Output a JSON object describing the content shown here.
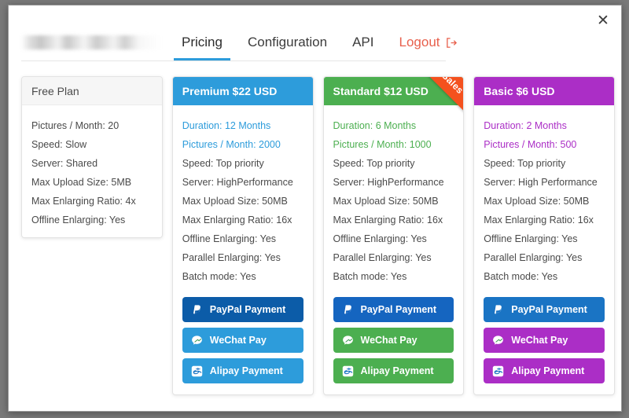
{
  "window": {
    "close_label": "✕"
  },
  "header": {
    "account_masked": "",
    "nav": [
      {
        "label": "Pricing",
        "active": true
      },
      {
        "label": "Configuration",
        "active": false
      },
      {
        "label": "API",
        "active": false
      },
      {
        "label": "Logout",
        "active": false,
        "icon": "logout-icon"
      }
    ]
  },
  "colors": {
    "premium": "#2d9cdb",
    "standard": "#4caf50",
    "basic": "#ab2ec6",
    "paypal": "#0c5ca8",
    "paypal_standard": "#1565c0",
    "paypal_basic": "#1a74c4",
    "ribbon": "#f4511e",
    "logout": "#e8604c"
  },
  "ribbon": {
    "label": "Hot Sales"
  },
  "plans": [
    {
      "id": "free",
      "title": "Free Plan",
      "header_style": "plain",
      "accent": "#4a4a4a",
      "features": [
        {
          "text": "Pictures / Month: 20",
          "accent": false
        },
        {
          "text": "Speed: Slow",
          "accent": false
        },
        {
          "text": "Server: Shared",
          "accent": false
        },
        {
          "text": "Max Upload Size: 5MB",
          "accent": false
        },
        {
          "text": "Max Enlarging Ratio: 4x",
          "accent": false
        },
        {
          "text": "Offline Enlarging: Yes",
          "accent": false
        }
      ],
      "payments": []
    },
    {
      "id": "premium",
      "title": "Premium $22 USD",
      "header_style": "filled",
      "accent": "#2d9cdb",
      "features": [
        {
          "text": "Duration: 12 Months",
          "accent": true
        },
        {
          "text": "Pictures / Month: 2000",
          "accent": true
        },
        {
          "text": "Speed: Top priority",
          "accent": false
        },
        {
          "text": "Server: HighPerformance",
          "accent": false
        },
        {
          "text": "Max Upload Size: 50MB",
          "accent": false
        },
        {
          "text": "Max Enlarging Ratio: 16x",
          "accent": false
        },
        {
          "text": "Offline Enlarging: Yes",
          "accent": false
        },
        {
          "text": "Parallel Enlarging: Yes",
          "accent": false
        },
        {
          "text": "Batch mode: Yes",
          "accent": false
        }
      ],
      "payments": [
        {
          "label": "PayPal Payment",
          "icon": "paypal-icon",
          "bg": "#0c5ca8"
        },
        {
          "label": "WeChat Pay",
          "icon": "wechat-icon",
          "bg": "#2d9cdb"
        },
        {
          "label": "Alipay Payment",
          "icon": "alipay-icon",
          "bg": "#2d9cdb"
        }
      ]
    },
    {
      "id": "standard",
      "title": "Standard $12 USD",
      "header_style": "filled",
      "accent": "#4caf50",
      "ribbon": true,
      "features": [
        {
          "text": "Duration: 6 Months",
          "accent": true
        },
        {
          "text": "Pictures / Month: 1000",
          "accent": true
        },
        {
          "text": "Speed: Top priority",
          "accent": false
        },
        {
          "text": "Server: HighPerformance",
          "accent": false
        },
        {
          "text": "Max Upload Size: 50MB",
          "accent": false
        },
        {
          "text": "Max Enlarging Ratio: 16x",
          "accent": false
        },
        {
          "text": "Offline Enlarging: Yes",
          "accent": false
        },
        {
          "text": "Parallel Enlarging: Yes",
          "accent": false
        },
        {
          "text": "Batch mode: Yes",
          "accent": false
        }
      ],
      "payments": [
        {
          "label": "PayPal Payment",
          "icon": "paypal-icon",
          "bg": "#1565c0"
        },
        {
          "label": "WeChat Pay",
          "icon": "wechat-icon",
          "bg": "#4caf50"
        },
        {
          "label": "Alipay Payment",
          "icon": "alipay-icon",
          "bg": "#4caf50"
        }
      ]
    },
    {
      "id": "basic",
      "title": "Basic $6 USD",
      "header_style": "filled",
      "accent": "#ab2ec6",
      "features": [
        {
          "text": "Duration: 2 Months",
          "accent": true
        },
        {
          "text": "Pictures / Month: 500",
          "accent": true
        },
        {
          "text": "Speed: Top priority",
          "accent": false
        },
        {
          "text": "Server: High Performance",
          "accent": false
        },
        {
          "text": "Max Upload Size: 50MB",
          "accent": false
        },
        {
          "text": "Max Enlarging Ratio: 16x",
          "accent": false
        },
        {
          "text": "Offline Enlarging: Yes",
          "accent": false
        },
        {
          "text": "Parallel Enlarging: Yes",
          "accent": false
        },
        {
          "text": "Batch mode: Yes",
          "accent": false
        }
      ],
      "payments": [
        {
          "label": "PayPal Payment",
          "icon": "paypal-icon",
          "bg": "#1a74c4"
        },
        {
          "label": "WeChat Pay",
          "icon": "wechat-icon",
          "bg": "#ab2ec6"
        },
        {
          "label": "Alipay Payment",
          "icon": "alipay-icon",
          "bg": "#ab2ec6"
        }
      ]
    }
  ]
}
